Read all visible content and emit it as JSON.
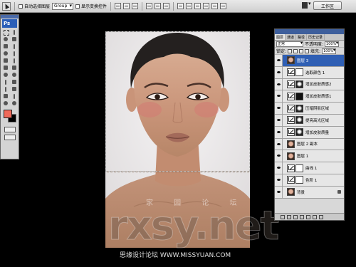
{
  "options_bar": {
    "auto_select_label": "自动选择图层",
    "group_select": "Group",
    "show_transform_label": "显示变换控件",
    "workspace_label": "工作区"
  },
  "tools": {
    "badge": "Ps",
    "foreground_color": "#f06a5a",
    "background_color": "#000000"
  },
  "canvas": {
    "watermark_cn": "思缘设计论坛",
    "watermark_en": "rxsy.net",
    "watermark_cn_small": "家 园 论 坛"
  },
  "bottom_watermark": "思缘设计论坛 WWW.MISSYUAN.COM",
  "layers_panel": {
    "tabs": [
      "图层",
      "通道",
      "路径",
      "历史记录"
    ],
    "blend_mode": "正常",
    "opacity_label": "不透明度:",
    "opacity_value": "100%",
    "lock_label": "锁定:",
    "fill_label": "填充:",
    "fill_value": "100%",
    "layers": [
      {
        "name": "图层 3",
        "selected": true,
        "thumb": "face",
        "mask": null
      },
      {
        "name": "选取颜色 1",
        "selected": false,
        "thumb": "adj",
        "mask": "mask-w"
      },
      {
        "name": "增加皮肤质感2",
        "selected": false,
        "thumb": "adj",
        "mask": "mask-g"
      },
      {
        "name": "增加皮肤质感1",
        "selected": false,
        "thumb": "adj",
        "mask": "mask-b"
      },
      {
        "name": "压暗阴影区域",
        "selected": false,
        "thumb": "adj",
        "mask": "mask-g"
      },
      {
        "name": "提亮高光区域",
        "selected": false,
        "thumb": "adj",
        "mask": "mask-g"
      },
      {
        "name": "增加皮肤质量",
        "selected": false,
        "thumb": "adj",
        "mask": "mask-g"
      },
      {
        "name": "图层 2 副本",
        "selected": false,
        "thumb": "face",
        "mask": null
      },
      {
        "name": "图层 1",
        "selected": false,
        "thumb": "face",
        "mask": null
      },
      {
        "name": "曲线 1",
        "selected": false,
        "thumb": "adj",
        "mask": "mask-w"
      },
      {
        "name": "色阶 1",
        "selected": false,
        "thumb": "adj",
        "mask": "mask-w"
      },
      {
        "name": "背景",
        "selected": false,
        "thumb": "face",
        "mask": null,
        "locked": true
      }
    ]
  }
}
